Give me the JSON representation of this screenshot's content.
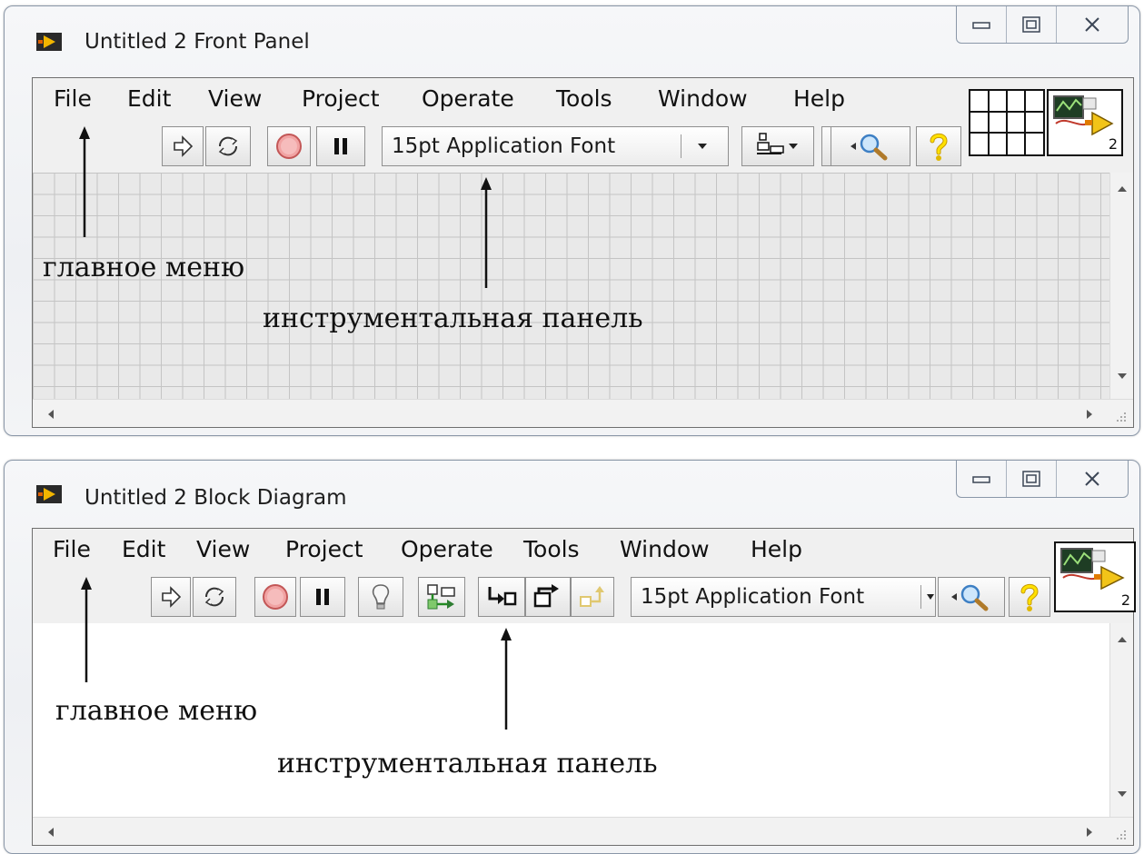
{
  "front_panel": {
    "title": "Untitled 2 Front Panel",
    "menu": [
      "File",
      "Edit",
      "View",
      "Project",
      "Operate",
      "Tools",
      "Window",
      "Help"
    ],
    "font_selector": "15pt Application Font",
    "icon_number": "2",
    "annotations": {
      "main_menu": "главное меню",
      "toolbar": "инструментальная панель"
    }
  },
  "block_diagram": {
    "title": "Untitled 2 Block Diagram",
    "menu": [
      "File",
      "Edit",
      "View",
      "Project",
      "Operate",
      "Tools",
      "Window",
      "Help"
    ],
    "font_selector": "15pt Application Font",
    "icon_number": "2",
    "annotations": {
      "main_menu": "главное меню",
      "toolbar": "инструментальная панель"
    }
  },
  "icons": {
    "run": "run-arrow-icon",
    "run_continuously": "run-continuously-icon",
    "abort": "abort-icon",
    "pause": "pause-icon",
    "highlight": "highlight-execution-icon",
    "retain_wire": "retain-wire-values-icon",
    "step_into": "step-into-icon",
    "step_over": "step-over-icon",
    "step_out": "step-out-icon",
    "align": "align-objects-icon",
    "search": "search-icon",
    "help": "context-help-icon"
  },
  "colors": {
    "canvas_grid": "#e9e9e9",
    "labview_accent": "#f2b600"
  }
}
